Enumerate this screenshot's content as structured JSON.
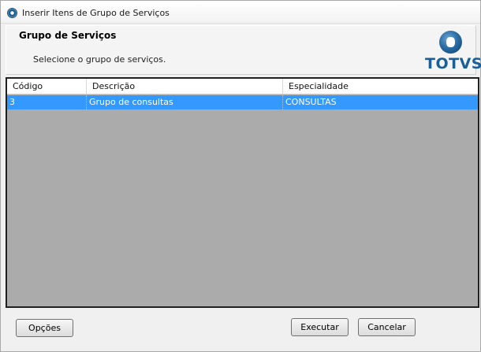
{
  "window": {
    "title": "Inserir Itens de Grupo de Serviços"
  },
  "header": {
    "heading": "Grupo de Serviços",
    "instruction": "Selecione o grupo de serviços.",
    "logo_text": "TOTVS"
  },
  "grid": {
    "columns": [
      "Código",
      "Descrição",
      "Especialidade"
    ],
    "rows": [
      {
        "codigo": "3",
        "descricao": "Grupo de consultas",
        "especialidade": "CONSULTAS",
        "selected": true
      }
    ]
  },
  "buttons": {
    "options": "Opções",
    "execute": "Executar",
    "cancel": "Cancelar"
  },
  "colors": {
    "selection": "#3399ff",
    "grid_background": "#ababab",
    "logo": "#1b5f96"
  }
}
